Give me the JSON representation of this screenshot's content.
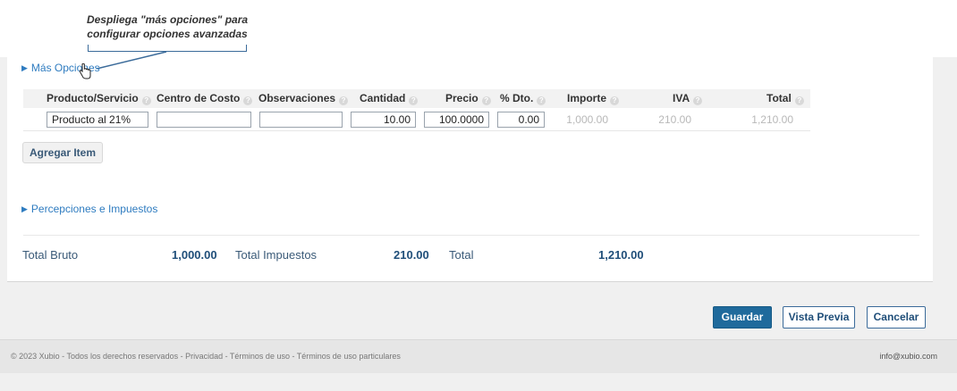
{
  "callout": {
    "line1": "Despliega \"más opciones\" para",
    "line2": "configurar opciones avanzadas"
  },
  "toggles": {
    "mas_opciones": "Más Opciones",
    "percepciones": "Percepciones e Impuestos"
  },
  "table": {
    "headers": [
      "Producto/Servicio",
      "Centro de Costo",
      "Observaciones",
      "Cantidad",
      "Precio",
      "% Dto.",
      "Importe",
      "IVA",
      "Total"
    ],
    "help_glyph": "?",
    "row": {
      "producto": "Producto al 21%",
      "centro_costo": "",
      "observaciones": "",
      "cantidad": "10.00",
      "precio": "100.0000",
      "descuento": "0.00",
      "importe": "1,000.00",
      "iva": "210.00",
      "total": "1,210.00"
    }
  },
  "add_item_label": "Agregar Item",
  "totals": {
    "bruto_label": "Total Bruto",
    "bruto_value": "1,000.00",
    "impuestos_label": "Total Impuestos",
    "impuestos_value": "210.00",
    "total_label": "Total",
    "total_value": "1,210.00"
  },
  "actions": {
    "guardar": "Guardar",
    "vista_previa": "Vista Previa",
    "cancelar": "Cancelar"
  },
  "footer": {
    "left": "© 2023 Xubio - Todos los derechos reservados - Privacidad - Términos de uso - Términos de uso particulares",
    "right": "info@xubio.com"
  },
  "colors": {
    "link": "#2f7cc0",
    "primary": "#1f6a9c",
    "accent_dark": "#1f4e79"
  }
}
